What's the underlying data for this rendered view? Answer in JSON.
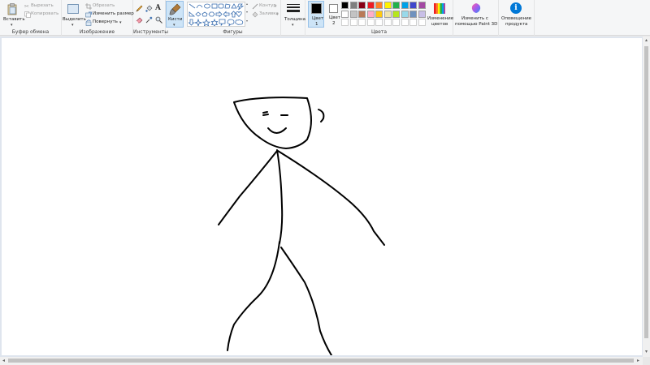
{
  "clipboard": {
    "paste_label": "Вставить",
    "cut_label": "Вырезать",
    "copy_label": "Копировать",
    "group_label": "Буфер обмена"
  },
  "image": {
    "select_label": "Выделить",
    "crop_label": "Обрезать",
    "resize_label": "Изменить размер",
    "rotate_label": "Повернуть",
    "group_label": "Изображение"
  },
  "tools": {
    "group_label": "Инструменты",
    "items": [
      "pencil-icon",
      "fill-icon",
      "text-icon",
      "eraser-icon",
      "color-picker-icon",
      "magnifier-icon"
    ],
    "text_glyph": "A"
  },
  "brushes": {
    "label": "Кисти"
  },
  "shapes": {
    "group_label": "Фигуры",
    "outline_label": "Контур",
    "fill_label": "Заливка"
  },
  "size": {
    "label": "Толщина"
  },
  "colors": {
    "color1_label": "Цвет",
    "color1_num": "1",
    "color2_label": "Цвет",
    "color2_num": "2",
    "group_label": "Цвета",
    "color1_value": "#000000",
    "color2_value": "#ffffff",
    "palette_row1": [
      "#000000",
      "#7f7f7f",
      "#880015",
      "#ed1c24",
      "#ff7f27",
      "#fff200",
      "#22b14c",
      "#00a2e8",
      "#3f48cc",
      "#a349a4"
    ],
    "palette_row2": [
      "#ffffff",
      "#c3c3c3",
      "#b97a57",
      "#ffaec9",
      "#ffc90e",
      "#efe4b0",
      "#b5e61d",
      "#99d9ea",
      "#7092be",
      "#c8bfe7"
    ],
    "edit_label_1": "Изменение",
    "edit_label_2": "цветов"
  },
  "paint3d": {
    "label_1": "Изменить с",
    "label_2": "помощью Paint 3D"
  },
  "notify": {
    "label_1": "Оповещение",
    "label_2": "продукта",
    "glyph": "i"
  },
  "accent_color": "#0078d7"
}
